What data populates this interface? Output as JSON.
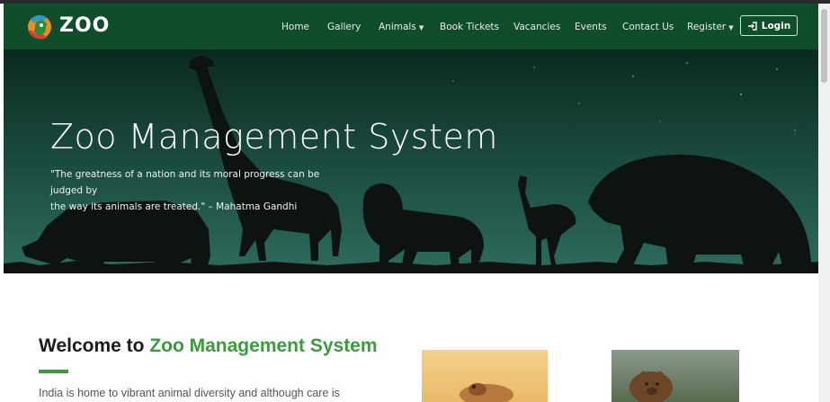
{
  "brand": {
    "name": "ZOO",
    "logo_icon": "zoo-animals-logo"
  },
  "nav": {
    "items": [
      {
        "label": "Home"
      },
      {
        "label": "Gallery"
      },
      {
        "label": "Animals",
        "dropdown": true
      },
      {
        "label": "Book Tickets"
      },
      {
        "label": "Vacancies"
      },
      {
        "label": "Events"
      },
      {
        "label": "Contact Us"
      },
      {
        "label": "Register",
        "dropdown": true
      }
    ],
    "login": {
      "label": "Login",
      "icon": "sign-in-icon"
    }
  },
  "hero": {
    "title": "Zoo Management System",
    "quote_line1": "\"The greatness of a nation and its moral progress can be judged by",
    "quote_line2": "the way its animals are treated.\" – Mahatma Gandhi"
  },
  "welcome": {
    "prefix": "Welcome to ",
    "highlight": "Zoo Management System",
    "intro": "India is home to vibrant animal diversity and although care is"
  },
  "colors": {
    "nav_bg": "#0f4d2b",
    "accent": "#3a9b3e",
    "hero_sky_top": "#0b2a1f",
    "hero_sky_bottom": "#2d6b5d"
  }
}
